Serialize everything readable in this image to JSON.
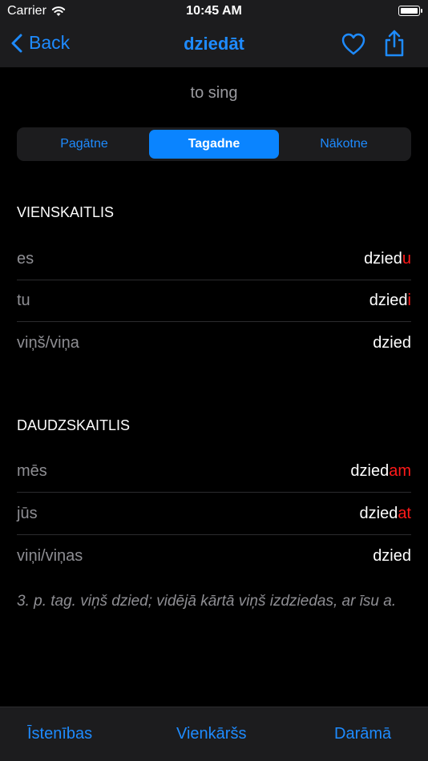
{
  "status": {
    "carrier": "Carrier",
    "time": "10:45 AM"
  },
  "nav": {
    "back_label": "Back",
    "title": "dziedāt"
  },
  "translation": "to sing",
  "tenses": [
    "Pagātne",
    "Tagadne",
    "Nākotne"
  ],
  "singular": {
    "header": "VIENSKAITLIS",
    "rows": [
      {
        "pronoun": "es",
        "stem": "dzied",
        "ending": "u"
      },
      {
        "pronoun": "tu",
        "stem": "dzied",
        "ending": "i"
      },
      {
        "pronoun": "viņš/viņa",
        "stem": "dzied",
        "ending": ""
      }
    ]
  },
  "plural": {
    "header": "DAUDZSKAITLIS",
    "rows": [
      {
        "pronoun": "mēs",
        "stem": "dzied",
        "ending": "am"
      },
      {
        "pronoun": "jūs",
        "stem": "dzied",
        "ending": "at"
      },
      {
        "pronoun": "viņi/viņas",
        "stem": "dzied",
        "ending": ""
      }
    ]
  },
  "note": "3. p. tag. viņš dzied; vidējā kārtā viņš izdziedas, ar īsu a.",
  "tabs": [
    "Īstenības",
    "Vienkāršs",
    "Darāmā"
  ],
  "colors": {
    "accent": "#1e8bff",
    "ending": "#ff1a1a",
    "active_segment": "#0a84ff"
  }
}
